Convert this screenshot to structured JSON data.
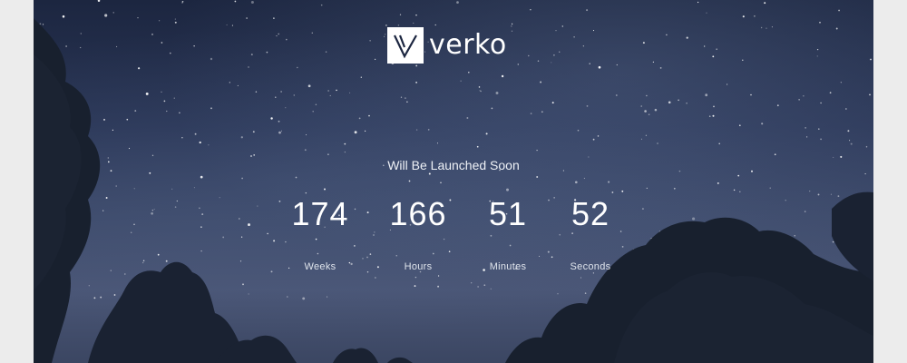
{
  "brand": {
    "name": "verko",
    "logo_icon": "verko-v-icon"
  },
  "launch": {
    "tagline": "Will Be Launched Soon"
  },
  "countdown": {
    "weeks": {
      "value": "174",
      "label": "Weeks"
    },
    "hours": {
      "value": "166",
      "label": "Hours"
    },
    "minutes": {
      "value": "51",
      "label": "Minutes"
    },
    "seconds": {
      "value": "52",
      "label": "Seconds"
    }
  },
  "colors": {
    "sky_top": "#1c2640",
    "sky_bottom": "#4a5676",
    "trees": "#1a2232",
    "page_bg": "#ececec",
    "text": "#ffffff"
  }
}
